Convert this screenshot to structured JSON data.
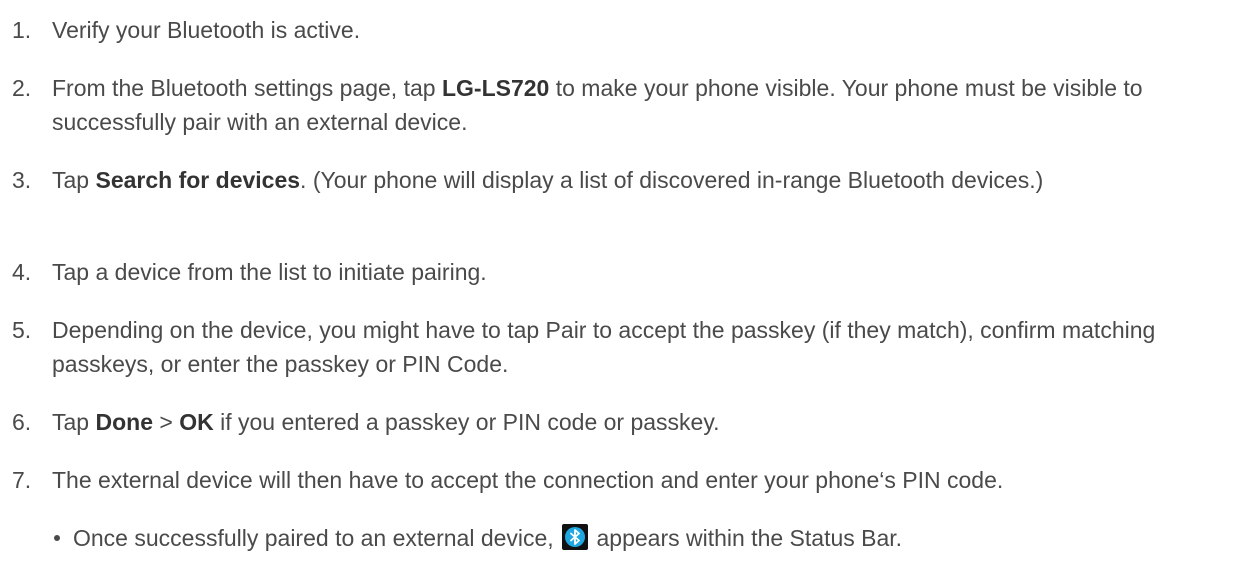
{
  "steps": [
    {
      "num": "1.",
      "parts": [
        {
          "t": "Verify your Bluetooth is active."
        }
      ]
    },
    {
      "num": "2.",
      "parts": [
        {
          "t": "From the Bluetooth settings page, tap "
        },
        {
          "t": "LG-LS720",
          "b": true
        },
        {
          "t": " to make your phone visible. Your phone must be visible to successfully pair with an external device."
        }
      ]
    },
    {
      "num": "3.",
      "parts": [
        {
          "t": "Tap "
        },
        {
          "t": "Search for devices",
          "b": true
        },
        {
          "t": ". (Your phone will display a list of discovered in-range Bluetooth devices.)"
        }
      ]
    },
    {
      "num": "4.",
      "parts": [
        {
          "t": "Tap a device from the list to initiate pairing."
        }
      ]
    },
    {
      "num": "5.",
      "parts": [
        {
          "t": "Depending on the device, you might have to tap Pair to accept the passkey (if they match), confirm matching passkeys, or enter the passkey or PIN Code."
        }
      ]
    },
    {
      "num": "6.",
      "parts": [
        {
          "t": "Tap "
        },
        {
          "t": "Done",
          "b": true
        },
        {
          "t": " > "
        },
        {
          "t": "OK",
          "b": true
        },
        {
          "t": " if you entered a passkey or PIN code or passkey."
        }
      ]
    },
    {
      "num": "7.",
      "parts": [
        {
          "t": "The external device will then have to accept the connection and enter your phone‘s PIN code."
        }
      ]
    }
  ],
  "bullet": {
    "before": "Once successfully paired to an external device, ",
    "icon": "bluetooth-status-icon",
    "after": " appears within the Status Bar."
  },
  "colors": {
    "text": "#4a4a4a",
    "icon_blue": "#1ea7e1",
    "icon_bg": "#111111"
  }
}
